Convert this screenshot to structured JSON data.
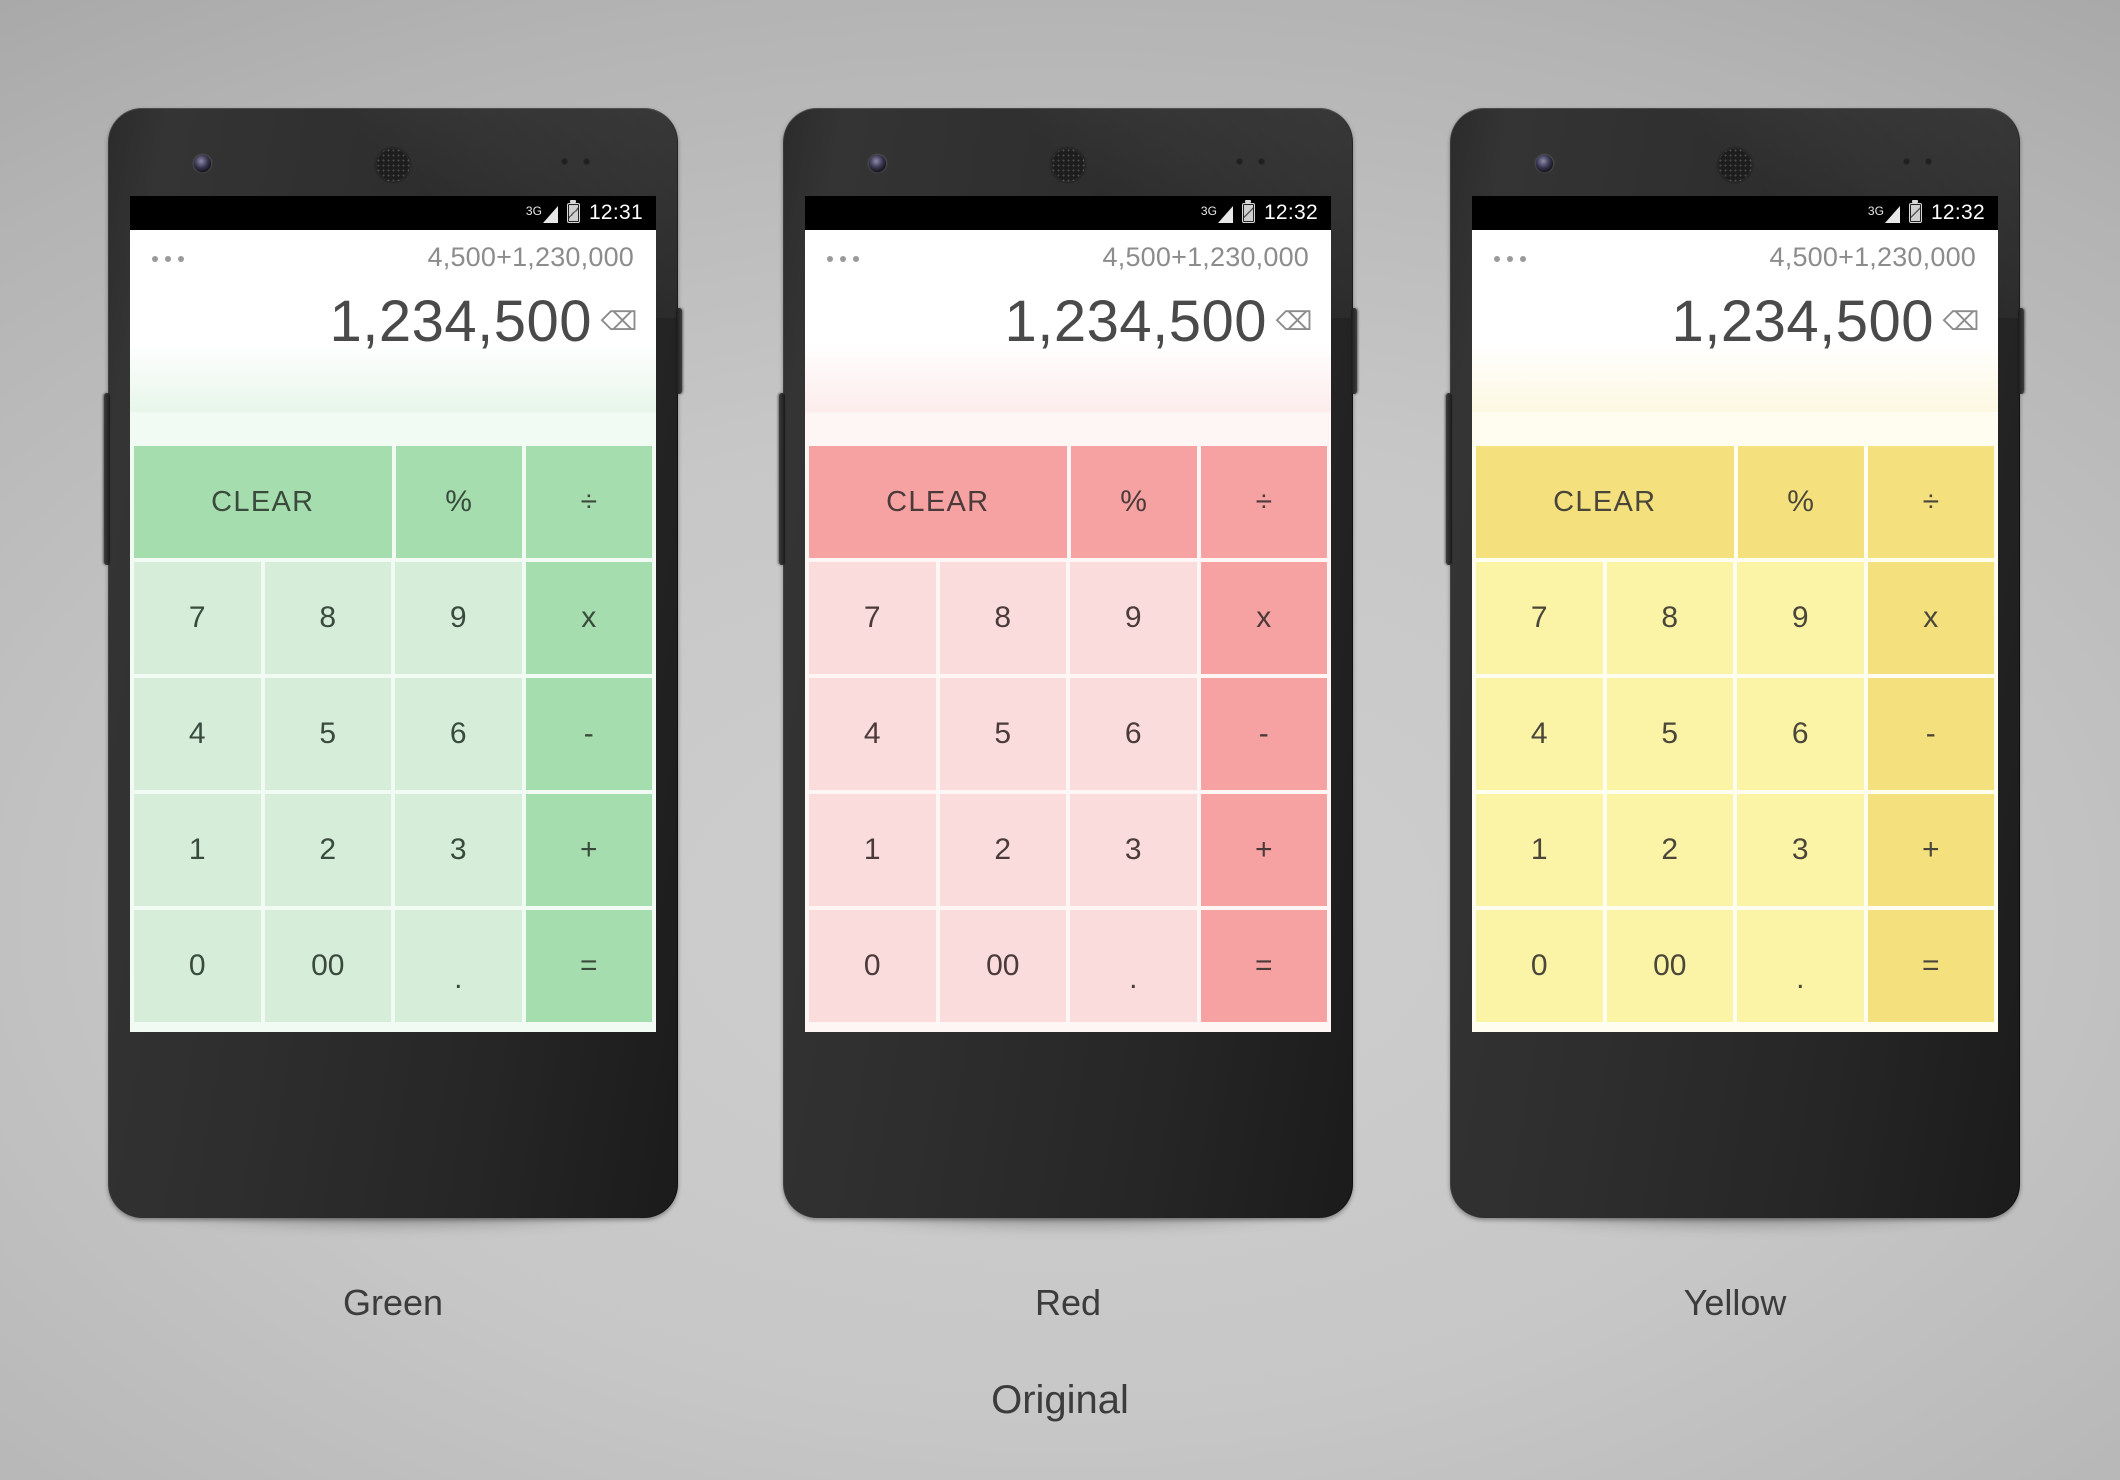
{
  "background": {
    "color_start": "#cfcfcf",
    "color_end": "#8a8a8a"
  },
  "overall_caption": "Original",
  "status_icons": {
    "network": "3G",
    "signal": "signal-icon",
    "battery": "battery-charging-icon"
  },
  "calculator": {
    "overflow_menu": "overflow-menu-icon",
    "expression": "4,500+1,230,000",
    "result": "1,234,500",
    "backspace_glyph": "⌫",
    "keys": {
      "row1": [
        "CLEAR",
        "%",
        "÷"
      ],
      "row2": [
        "7",
        "8",
        "9",
        "x"
      ],
      "row3": [
        "4",
        "5",
        "6",
        "-"
      ],
      "row4": [
        "1",
        "2",
        "3",
        "+"
      ],
      "row5": [
        "0",
        "00",
        ".",
        "="
      ]
    }
  },
  "navbar": {
    "back": "back-icon",
    "home": "home-icon",
    "recents": "recents-icon"
  },
  "phones": [
    {
      "caption": "Green",
      "clock": "12:31",
      "theme": {
        "accent": "#a5ddae",
        "light": "#d5edd9",
        "display_tint_top": "#ffffff",
        "display_tint_bottom": "#e7f6ea",
        "gap": "#f2fbf3",
        "text": "#3a4a3c"
      }
    },
    {
      "caption": "Red",
      "clock": "12:32",
      "theme": {
        "accent": "#f7a2a2",
        "light": "#fbdcdc",
        "display_tint_top": "#ffffff",
        "display_tint_bottom": "#fdecec",
        "gap": "#fef5f5",
        "text": "#4a3a3a"
      }
    },
    {
      "caption": "Yellow",
      "clock": "12:32",
      "theme": {
        "accent": "#f5e07e",
        "light": "#fbf3a5",
        "display_tint_top": "#ffffff",
        "display_tint_bottom": "#fdf8e2",
        "gap": "#fffdf0",
        "text": "#4a463a"
      }
    }
  ]
}
